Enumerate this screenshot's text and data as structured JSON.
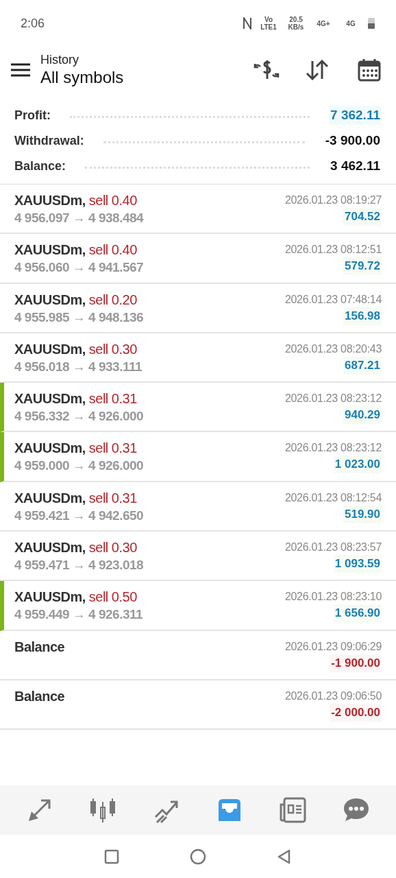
{
  "status_bar": {
    "time": "2:06",
    "indicators": [
      "Vo LTE1",
      "20.5 KB/s",
      "4G+",
      "4G"
    ]
  },
  "header": {
    "title": "History",
    "subtitle": "All symbols"
  },
  "summary": [
    {
      "label": "Profit:",
      "value": "7 362.11",
      "highlight": true
    },
    {
      "label": "Withdrawal:",
      "value": "-3 900.00",
      "highlight": false
    },
    {
      "label": "Balance:",
      "value": "3 462.11",
      "highlight": false
    }
  ],
  "deals": [
    {
      "kind": "trade",
      "symbol": "XAUUSDm,",
      "action": "sell 0.40",
      "prices": "4 956.097 → 4 938.484",
      "time": "2026.01.23 08:19:27",
      "profit": "704.52",
      "positive": true,
      "marked": false
    },
    {
      "kind": "trade",
      "symbol": "XAUUSDm,",
      "action": "sell 0.40",
      "prices": "4 956.060 → 4 941.567",
      "time": "2026.01.23 08:12:51",
      "profit": "579.72",
      "positive": true,
      "marked": false
    },
    {
      "kind": "trade",
      "symbol": "XAUUSDm,",
      "action": "sell 0.20",
      "prices": "4 955.985 → 4 948.136",
      "time": "2026.01.23 07:48:14",
      "profit": "156.98",
      "positive": true,
      "marked": false
    },
    {
      "kind": "trade",
      "symbol": "XAUUSDm,",
      "action": "sell 0.30",
      "prices": "4 956.018 → 4 933.111",
      "time": "2026.01.23 08:20:43",
      "profit": "687.21",
      "positive": true,
      "marked": false
    },
    {
      "kind": "trade",
      "symbol": "XAUUSDm,",
      "action": "sell 0.31",
      "prices": "4 956.332 → 4 926.000",
      "time": "2026.01.23 08:23:12",
      "profit": "940.29",
      "positive": true,
      "marked": true
    },
    {
      "kind": "trade",
      "symbol": "XAUUSDm,",
      "action": "sell 0.31",
      "prices": "4 959.000 → 4 926.000",
      "time": "2026.01.23 08:23:12",
      "profit": "1 023.00",
      "positive": true,
      "marked": true
    },
    {
      "kind": "trade",
      "symbol": "XAUUSDm,",
      "action": "sell 0.31",
      "prices": "4 959.421 → 4 942.650",
      "time": "2026.01.23 08:12:54",
      "profit": "519.90",
      "positive": true,
      "marked": false
    },
    {
      "kind": "trade",
      "symbol": "XAUUSDm,",
      "action": "sell 0.30",
      "prices": "4 959.471 → 4 923.018",
      "time": "2026.01.23 08:23:57",
      "profit": "1 093.59",
      "positive": true,
      "marked": false
    },
    {
      "kind": "trade",
      "symbol": "XAUUSDm,",
      "action": "sell 0.50",
      "prices": "4 959.449 → 4 926.311",
      "time": "2026.01.23 08:23:10",
      "profit": "1 656.90",
      "positive": true,
      "marked": true
    },
    {
      "kind": "balance",
      "symbol": "Balance",
      "time": "2026.01.23 09:06:29",
      "profit": "-1 900.00",
      "positive": false,
      "marked": false
    },
    {
      "kind": "balance",
      "symbol": "Balance",
      "time": "2026.01.23 09:06:50",
      "profit": "-2 000.00",
      "positive": false,
      "marked": false
    }
  ],
  "bottom_nav": [
    {
      "kind": "quotes",
      "selected": false
    },
    {
      "kind": "chart",
      "selected": false
    },
    {
      "kind": "trade",
      "selected": false
    },
    {
      "kind": "history",
      "selected": true
    },
    {
      "kind": "news",
      "selected": false
    },
    {
      "kind": "chat",
      "selected": false
    }
  ]
}
